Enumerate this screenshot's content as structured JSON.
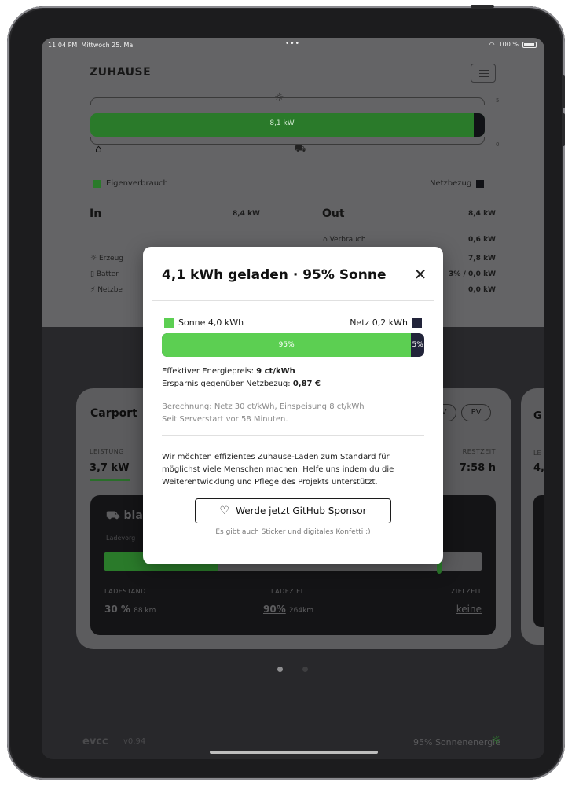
{
  "statusbar": {
    "time": "11:04 PM",
    "date": "Mittwoch 25. Mai",
    "dots": "•••",
    "battery": "100 %"
  },
  "header": {
    "title": "ZUHAUSE"
  },
  "energyflow": {
    "bar_label": "8,1 kW",
    "legend_left": "Eigenverbrauch",
    "legend_right": "Netzbezug",
    "side_top": "5",
    "side_bottom": "0",
    "in": {
      "title": "In",
      "total": "8,4 kW",
      "rows": [
        {
          "label": "Erzeug"
        },
        {
          "label": "Batter"
        },
        {
          "label": "Netzbe"
        }
      ]
    },
    "out": {
      "title": "Out",
      "total": "8,4 kW",
      "rows": [
        {
          "label": "Verbrauch",
          "value": "0,6 kW"
        },
        {
          "label": "",
          "value": "7,8 kW"
        },
        {
          "label": "",
          "value": "3% / 0,0 kW"
        },
        {
          "label": "",
          "value": "0,0 kW"
        }
      ]
    }
  },
  "loadpoint": {
    "title": "Carport",
    "mode_buttons": [
      "PV",
      "PV"
    ],
    "power_label": "LEISTUNG",
    "power_value": "3,7 kW",
    "remaining_label": "RESTZEIT",
    "remaining_value": "7:58 h",
    "vehicle_name": "bla",
    "vehicle_sub": "Ladevorg",
    "soc_label": "LADESTAND",
    "soc_value": "30 %",
    "soc_range": "88 km",
    "target_label": "LADEZIEL",
    "target_value": "90%",
    "target_range": "264km",
    "target_time_label": "ZIELZEIT",
    "target_time_value": "keine",
    "charge_fraction": 0.3,
    "second_card_letter": "G",
    "second_card_cap": "LE",
    "second_card_val": "4,"
  },
  "footer": {
    "logo": "evcc",
    "version": "v0.94",
    "solar": "95% Sonnenenergie"
  },
  "modal": {
    "title": "4,1 kWh geladen · 95% Sonne",
    "close": "✕",
    "legend_sun": "Sonne 4,0 kWh",
    "legend_grid": "Netz 0,2 kWh",
    "sun_percent": 95,
    "sun_label": "95%",
    "grid_label": "5%",
    "price_label": "Effektiver Energiepreis: ",
    "price_value": "9 ct/kWh",
    "savings_label": "Ersparnis gegenüber Netzbezug: ",
    "savings_value": "0,87 €",
    "calc_link": "Berechnung",
    "calc_text": ": Netz 30 ct/kWh, Einspeisung 8 ct/kWh",
    "since": "Seit Serverstart vor 58 Minuten.",
    "paragraph": "Wir möchten effizientes Zuhause-Laden zum Standard für möglichst viele Menschen machen. Helfe uns indem du die Weiterentwicklung und Pflege des Projekts unterstützt.",
    "sponsor_button": "Werde jetzt GitHub Sponsor",
    "hint": "Es gibt auch Sticker und digitales Konfetti ;)"
  },
  "colors": {
    "sun": "#5ccf52",
    "grid": "#22243a",
    "dim_green": "#2a7a2a"
  }
}
